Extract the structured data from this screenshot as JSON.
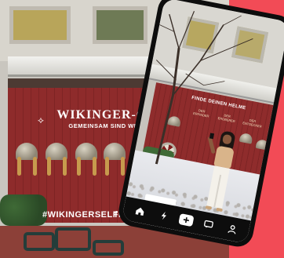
{
  "mural": {
    "title": "WIKINGER-CREW",
    "subtitle": "GEMEINSAM SIND WIR STARK!",
    "hashtag": "#WIKINGERSELFIE",
    "social_icons": [
      "facebook-icon",
      "instagram-icon"
    ]
  },
  "phone_screen": {
    "mural_title": "FINDE DEINEN HELME",
    "signs": [
      "DER ERFINDER",
      "DER EROBERER",
      "DER ENTDECKER"
    ]
  },
  "nav": {
    "items": [
      "home-icon",
      "discover-icon",
      "create-icon",
      "inbox-icon",
      "profile-icon"
    ]
  },
  "colors": {
    "background": "#f24b56",
    "mural_red": "#8e2b2b",
    "nav_bg": "#0d0d0d"
  }
}
